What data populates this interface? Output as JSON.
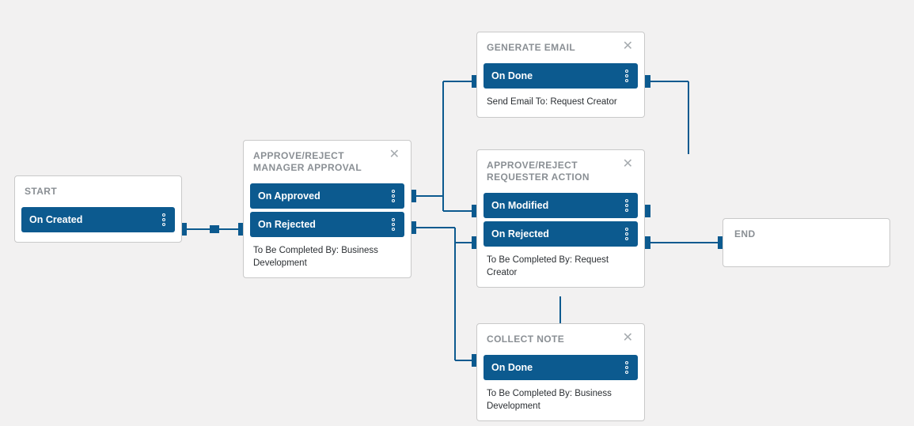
{
  "colors": {
    "accent": "#0c5a8f",
    "node_border": "#c9c9c9",
    "bg": "#f2f1f1",
    "title_gray": "#8a8f94"
  },
  "nodes": {
    "start": {
      "title": "START",
      "actions": [
        {
          "label": "On Created"
        }
      ]
    },
    "manager": {
      "title": "APPROVE/REJECT MANAGER APPROVAL",
      "actions": [
        {
          "label": "On Approved"
        },
        {
          "label": "On Rejected"
        }
      ],
      "footer": "To Be Completed By: Business Development"
    },
    "generate_email": {
      "title": "GENERATE EMAIL",
      "actions": [
        {
          "label": "On Done"
        }
      ],
      "footer": "Send Email To: Request Creator"
    },
    "requester": {
      "title": "APPROVE/REJECT REQUESTER ACTION",
      "actions": [
        {
          "label": "On Modified"
        },
        {
          "label": "On Rejected"
        }
      ],
      "footer": "To Be Completed By: Request Creator"
    },
    "collect_note": {
      "title": "COLLECT NOTE",
      "actions": [
        {
          "label": "On Done"
        }
      ],
      "footer": "To Be Completed By: Business Development"
    },
    "end": {
      "title": "END"
    }
  }
}
